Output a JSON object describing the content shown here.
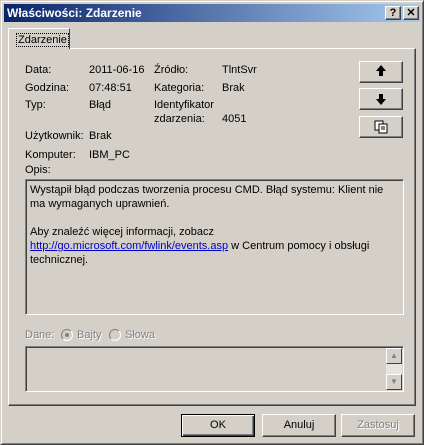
{
  "window": {
    "title": "Właściwości: Zdarzenie"
  },
  "caption_buttons": {
    "help": "?",
    "close": "✕"
  },
  "tab": {
    "label": "Zdarzenie"
  },
  "fields": {
    "data_label": "Data:",
    "data_value": "2011-06-16",
    "zrodlo_label": "Źródło:",
    "zrodlo_value": "TlntSvr",
    "godzina_label": "Godzina:",
    "godzina_value": "07:48:51",
    "kategoria_label": "Kategoria:",
    "kategoria_value": "Brak",
    "typ_label": "Typ:",
    "typ_value": "Błąd",
    "identyfikator_label_line1": "Identyfikator",
    "identyfikator_label_line2": "zdarzenia:",
    "identyfikator_value": "4051",
    "uzytkownik_label": "Użytkownik:",
    "uzytkownik_value": "Brak",
    "komputer_label": "Komputer:",
    "komputer_value": "IBM_PC",
    "opis_label": "Opis:"
  },
  "side_buttons": {
    "up_icon": "arrow-up",
    "down_icon": "arrow-down",
    "copy_icon": "copy"
  },
  "description": {
    "line1": "Wystąpił błąd podczas tworzenia procesu CMD. Błąd systemu: Klient nie ma wymaganych uprawnień.",
    "more_info": "Aby znaleźć więcej informacji, zobacz",
    "link": "http://go.microsoft.com/fwlink/events.asp",
    "after_link": " w Centrum pomocy i obsługi technicznej."
  },
  "data_section": {
    "label": "Dane:",
    "bytes_label": "Bajty",
    "words_label": "Słowa",
    "selected": "Bajty"
  },
  "buttons": {
    "ok": "OK",
    "cancel": "Anuluj",
    "apply": "Zastosuj"
  },
  "colors": {
    "titlebar_start": "#0a246a",
    "titlebar_end": "#a6caf0",
    "face": "#d4d0c8",
    "link": "#0000cc"
  }
}
